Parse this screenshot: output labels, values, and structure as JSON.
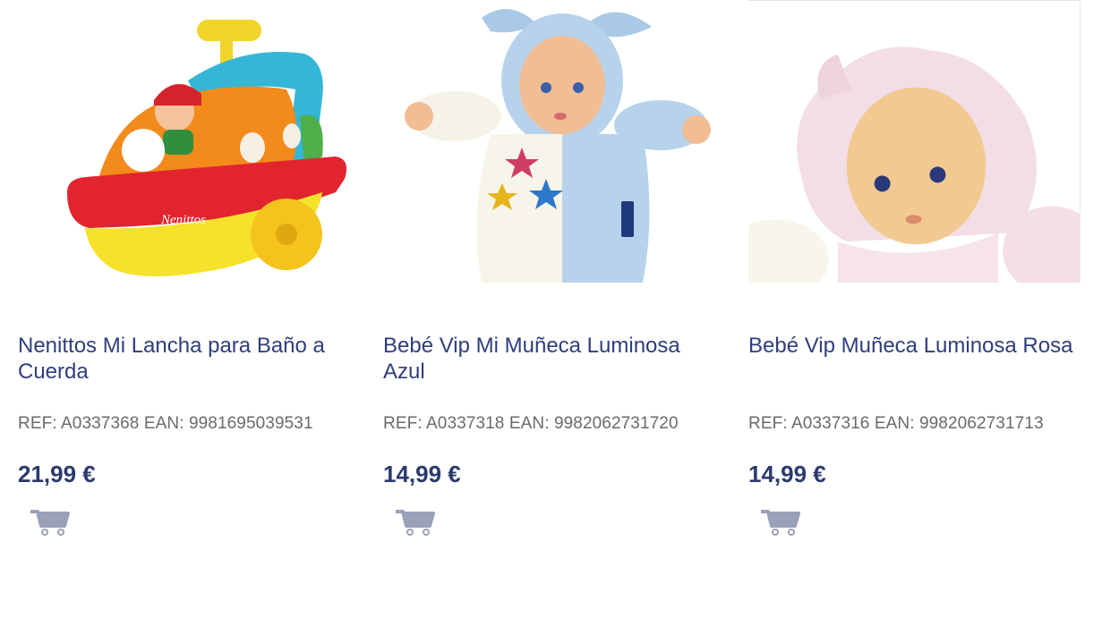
{
  "products": [
    {
      "title": "Nenittos Mi Lancha para Baño a Cuerda",
      "ref": "REF: A0337368 EAN: 9981695039531",
      "price": "21,99 €",
      "image_label": "Nenittos"
    },
    {
      "title": "Bebé Vip Mi Muñeca Luminosa Azul",
      "ref": "REF: A0337318 EAN: 9982062731720",
      "price": "14,99 €"
    },
    {
      "title": "Bebé Vip Muñeca Luminosa Rosa",
      "ref": "REF: A0337316 EAN: 9982062731713",
      "price": "14,99 €"
    }
  ],
  "colors": {
    "title": "#2f3e7d",
    "price": "#2b3a6e",
    "ref": "#6a6a6a",
    "cart_icon": "#9aa0b8"
  },
  "icons": {
    "cart": "shopping-cart-icon"
  }
}
